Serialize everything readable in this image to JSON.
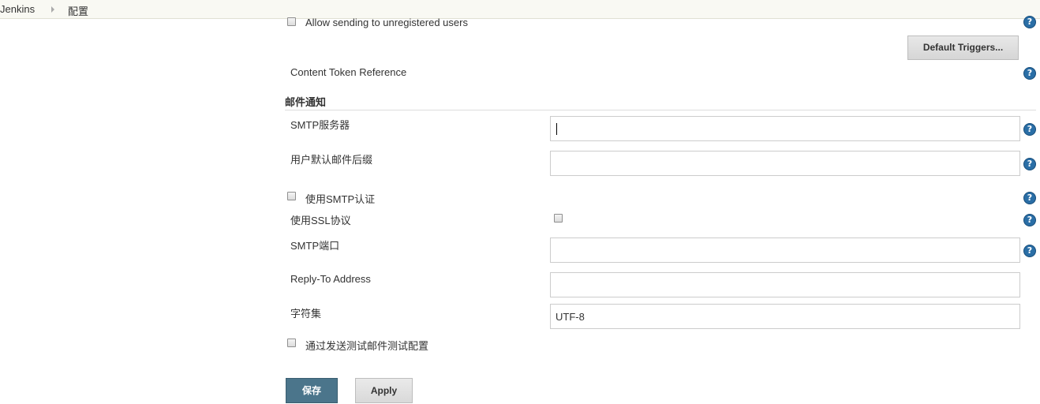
{
  "breadcrumb": {
    "items": [
      {
        "label": "Jenkins"
      },
      {
        "label": "配置"
      }
    ]
  },
  "extended_email": {
    "allow_unregistered_label": "Allow sending to unregistered users",
    "default_triggers_label": "Default Triggers...",
    "content_token_label": "Content Token Reference"
  },
  "mail_section": {
    "title": "邮件通知",
    "smtp_server_label": "SMTP服务器",
    "smtp_server_value": "",
    "default_suffix_label": "用户默认邮件后缀",
    "default_suffix_value": "",
    "use_smtp_auth_label": "使用SMTP认证",
    "use_ssl_label": "使用SSL协议",
    "smtp_port_label": "SMTP端口",
    "smtp_port_value": "",
    "reply_to_label": "Reply-To Address",
    "reply_to_value": "",
    "charset_label": "字符集",
    "charset_value": "UTF-8",
    "test_config_label": "通过发送测试邮件测试配置"
  },
  "actions": {
    "save_label": "保存",
    "apply_label": "Apply"
  },
  "help_icon_glyph": "?",
  "colors": {
    "save_button": "#4b758b",
    "help_icon": "#2a6ea6",
    "breadcrumb_bg": "#f9f9f3"
  }
}
